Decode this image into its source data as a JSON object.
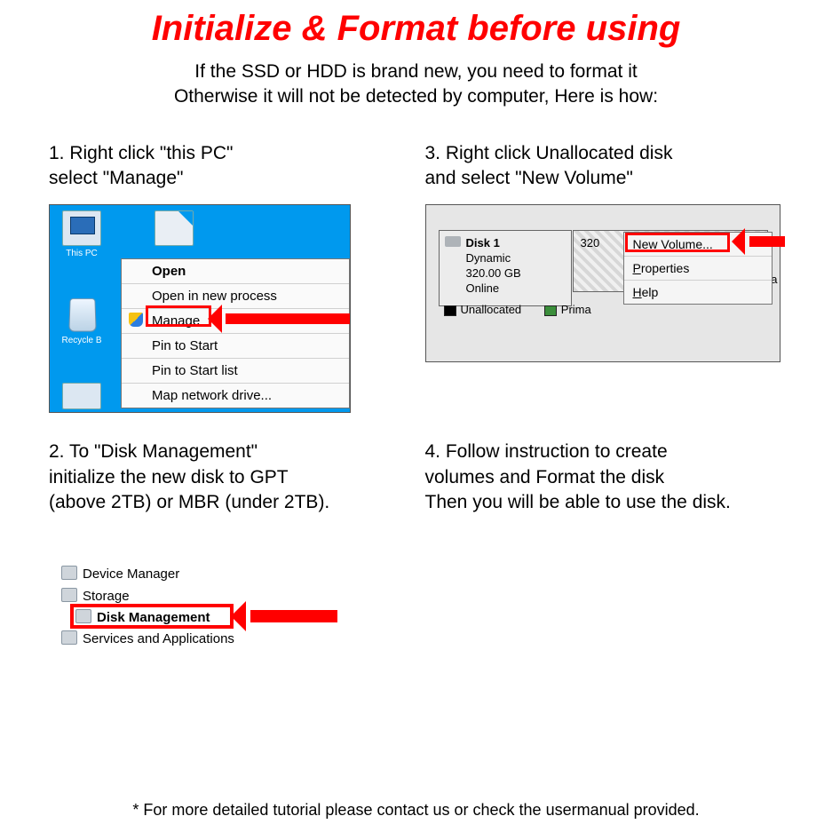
{
  "title": "Initialize & Format before using",
  "subtitle_line1": "If the SSD or HDD is brand new, you need to format it",
  "subtitle_line2": "Otherwise it will not be detected by computer, Here is how:",
  "steps": {
    "s1_line1": "1. Right click \"this PC\"",
    "s1_line2": "select \"Manage\"",
    "s2_line1": "2. To \"Disk Management\"",
    "s2_line2": "initialize the new disk to GPT",
    "s2_line3": "(above 2TB) or MBR (under 2TB).",
    "s3_line1": "3. Right click Unallocated disk",
    "s3_line2": "and select \"New Volume\"",
    "s4_line1": "4. Follow instruction to create",
    "s4_line2": "volumes and Format the disk",
    "s4_line3": "Then you will be able to use the disk."
  },
  "shot1": {
    "icon_pc": "This PC",
    "icon_bin": "Recycle B",
    "menu": {
      "open": "Open",
      "open_new": "Open in new process",
      "manage": "Manage",
      "pin_start": "Pin to Start",
      "pin_list": "Pin to Start list",
      "map": "Map network drive..."
    }
  },
  "shot3": {
    "disk_title": "Disk 1",
    "disk_type": "Dynamic",
    "disk_size": "320.00 GB",
    "disk_status": "Online",
    "vol_size": "320",
    "vol_trail": "d pa",
    "legend_unalloc": "Unallocated",
    "legend_primary": "Prima",
    "menu": {
      "new_volume": "New Volume...",
      "properties": "Properties",
      "help": "Help"
    }
  },
  "shot2": {
    "device_manager": "Device Manager",
    "storage": "Storage",
    "disk_mgmt": "Disk Management",
    "services": "Services and Applications"
  },
  "footnote": "* For more detailed tutorial please contact us or check the usermanual provided."
}
